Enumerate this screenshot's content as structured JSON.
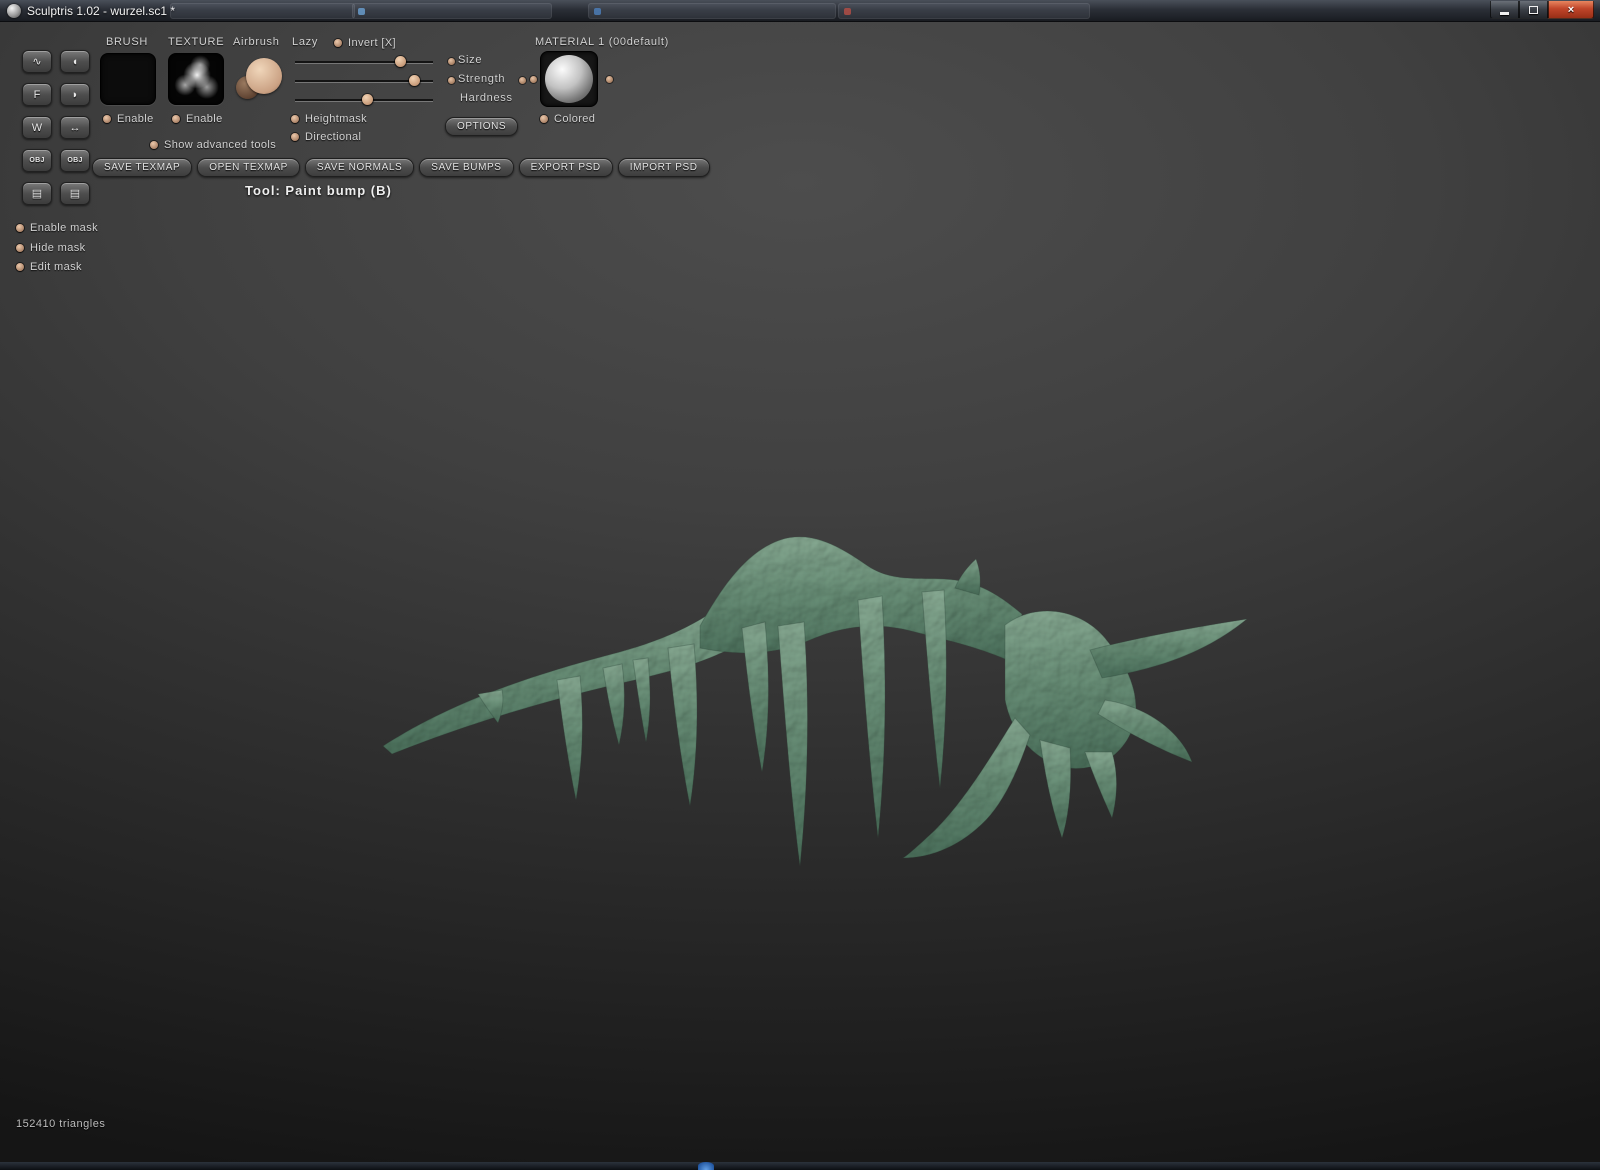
{
  "window": {
    "title": "Sculptris 1.02 - wurzel.sc1 *",
    "close_glyph": "×"
  },
  "panel": {
    "brush": {
      "header": "BRUSH",
      "enable_label": "Enable"
    },
    "texture": {
      "header": "TEXTURE",
      "enable_label": "Enable"
    },
    "airbrush_label": "Airbrush",
    "lazy_label": "Lazy",
    "invert_label": "Invert [X]",
    "sliders": {
      "size_label": "Size",
      "size_value": 0.76,
      "strength_label": "Strength",
      "strength_value": 0.86,
      "hardness_label": "Hardness",
      "hardness_value": 0.52
    },
    "heightmask_label": "Heightmask",
    "directional_label": "Directional",
    "options_button": "OPTIONS",
    "material": {
      "header": "MATERIAL 1 (00default)",
      "colored_label": "Colored"
    },
    "show_advanced_label": "Show advanced tools",
    "actions": [
      "SAVE TEXMAP",
      "OPEN TEXMAP",
      "SAVE NORMALS",
      "SAVE BUMPS",
      "EXPORT PSD",
      "IMPORT PSD"
    ],
    "tool_status": "Tool: Paint bump (B)"
  },
  "mask": {
    "items": [
      "Enable mask",
      "Hide mask",
      "Edit mask"
    ]
  },
  "side_toolbar": {
    "buttons": [
      {
        "name": "draw-tool",
        "glyph": "∿"
      },
      {
        "name": "clay-tool",
        "glyph": "◖"
      },
      {
        "name": "flatten-tool",
        "glyph": "F"
      },
      {
        "name": "smooth-tool",
        "glyph": "◗"
      },
      {
        "name": "wireframe-toggle",
        "glyph": "W"
      },
      {
        "name": "symmetry-toggle",
        "glyph": "↔"
      },
      {
        "name": "import-obj-button",
        "glyph": "OBJ"
      },
      {
        "name": "export-obj-button",
        "glyph": "OBJ"
      },
      {
        "name": "open-file-button",
        "glyph": "▤"
      },
      {
        "name": "save-file-button",
        "glyph": "▤"
      }
    ]
  },
  "status": {
    "triangles": "152410 triangles"
  },
  "colors": {
    "accent_tan": "#d9b393",
    "model_green": "#7da390",
    "viewport_top": "#4a4a4a",
    "viewport_bottom": "#141414",
    "close_red": "#c0452a"
  }
}
